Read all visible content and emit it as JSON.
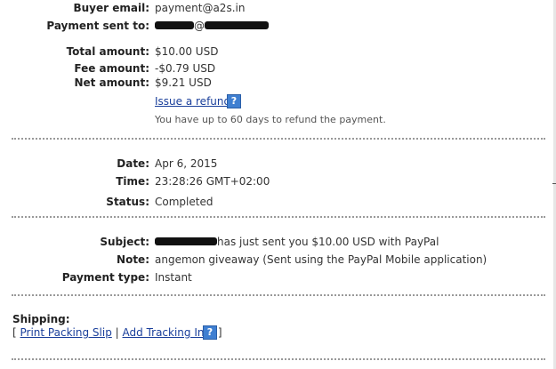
{
  "payment": {
    "buyer_email_label": "Buyer email:",
    "buyer_email": "payment@a2s.in",
    "sent_to_label": "Payment sent to:",
    "sent_to_visible": "@",
    "total_label": "Total amount:",
    "total": "$10.00 USD",
    "fee_label": "Fee amount:",
    "fee": "-$0.79 USD",
    "net_label": "Net amount:",
    "net": "$9.21 USD",
    "refund_link": "Issue a refund",
    "refund_note": "You have up to 60 days to refund the payment."
  },
  "details": {
    "date_label": "Date:",
    "date": "Apr 6, 2015",
    "time_label": "Time:",
    "time": "23:28:26 GMT+02:00",
    "status_label": "Status:",
    "status": "Completed"
  },
  "message": {
    "subject_label": "Subject:",
    "subject_text": "has just sent you $10.00 USD with PayPal",
    "note_label": "Note:",
    "note": "angemon giveaway (Sent using the PayPal Mobile application)",
    "payment_type_label": "Payment type:",
    "payment_type": "Instant"
  },
  "shipping": {
    "title": "Shipping:",
    "open_bracket": "[",
    "print_slip": "Print Packing Slip",
    "separator": "|",
    "tracking": "Add Tracking Info",
    "close_bracket": "]"
  },
  "icons": {
    "help_glyph": "?",
    "help_color": "#3f7fd1",
    "link_color": "#1a3f9b"
  }
}
